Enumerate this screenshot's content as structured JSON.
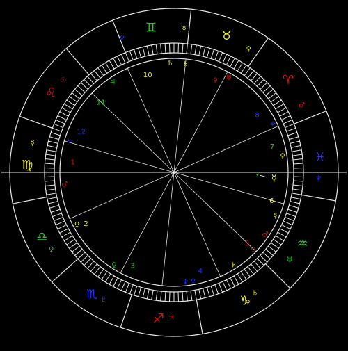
{
  "colors": {
    "background": "#000000",
    "lines": "#e6e6e6",
    "fire": "#e01010",
    "earth": "#f0f020",
    "air": "#20d020",
    "water": "#2030ff"
  },
  "zodiac_ring": [
    {
      "glyph": "♊",
      "name": "gemini-icon",
      "color": "#20d020",
      "angle": 99
    },
    {
      "glyph": "♉",
      "name": "taurus-icon",
      "color": "#f0f020",
      "angle": 69
    },
    {
      "glyph": "♈",
      "name": "aries-icon",
      "color": "#e01010",
      "angle": 39
    },
    {
      "glyph": "♓",
      "name": "pisces-icon",
      "color": "#2030ff",
      "angle": 6
    },
    {
      "glyph": "♒",
      "name": "aquarius-icon",
      "color": "#20d020",
      "angle": -29
    },
    {
      "glyph": "♑",
      "name": "capricorn-icon",
      "color": "#f0f020",
      "angle": -61
    },
    {
      "glyph": "♐",
      "name": "sagittarius-icon",
      "color": "#e01010",
      "angle": -96
    },
    {
      "glyph": "♏",
      "name": "scorpio-icon",
      "color": "#2030ff",
      "angle": -124
    },
    {
      "glyph": "♎",
      "name": "libra-icon",
      "color": "#20d020",
      "angle": -154
    },
    {
      "glyph": "♍",
      "name": "virgo-icon",
      "color": "#f0f020",
      "angle": 177
    },
    {
      "glyph": "♌",
      "name": "leo-icon",
      "color": "#e01010",
      "angle": 147
    }
  ],
  "ruler_glyphs": [
    {
      "glyph": "☿",
      "name": "mercury-ruler-icon",
      "color": "#f0f020",
      "angle": 86
    },
    {
      "glyph": "♀",
      "name": "venus-ruler-icon",
      "color": "#f0f020",
      "angle": 59
    },
    {
      "glyph": "♂",
      "name": "mars-ruler-icon",
      "color": "#e01010",
      "angle": 28
    },
    {
      "glyph": "♆",
      "name": "neptune-ruler-icon",
      "color": "#2030ff",
      "angle": -2
    },
    {
      "glyph": "♅",
      "name": "uranus-ruler-icon",
      "color": "#20d020",
      "angle": -37
    },
    {
      "glyph": "♄",
      "name": "saturn-ruler-icon",
      "color": "#f0f020",
      "angle": -56
    },
    {
      "glyph": "♃",
      "name": "jupiter-ruler-icon",
      "color": "#e01010",
      "angle": -91
    },
    {
      "glyph": "♇",
      "name": "pluto-ruler-icon",
      "color": "#2030ff",
      "angle": -119
    },
    {
      "glyph": "♀",
      "name": "venus-ruler-icon-2",
      "color": "#20d020",
      "angle": -148
    },
    {
      "glyph": "☿",
      "name": "mercury-ruler-icon-2",
      "color": "#f0f020",
      "angle": 168
    },
    {
      "glyph": "☉",
      "name": "sun-ruler-icon",
      "color": "#e01010",
      "angle": 140
    },
    {
      "glyph": "♆",
      "name": "neptune-ruler-icon-2",
      "color": "#2030ff",
      "angle": 111
    }
  ],
  "houses": [
    {
      "label": "10",
      "color": "#f0f020",
      "angle": 105
    },
    {
      "label": "9",
      "color": "#e01010",
      "angle": 66
    },
    {
      "label": "8",
      "color": "#2030ff",
      "angle": 35
    },
    {
      "label": "7",
      "color": "#20d020",
      "angle": 15
    },
    {
      "label": "6",
      "color": "#f0f020",
      "angle": -16
    },
    {
      "label": "5",
      "color": "#e01010",
      "angle": -44
    },
    {
      "label": "4",
      "color": "#2030ff",
      "angle": -75
    },
    {
      "label": "3",
      "color": "#20d020",
      "angle": -114
    },
    {
      "label": "2",
      "color": "#f0f020",
      "angle": -150
    },
    {
      "label": "1",
      "color": "#e01010",
      "angle": 174
    },
    {
      "label": "12",
      "color": "#2030ff",
      "angle": 156
    },
    {
      "label": "11",
      "color": "#20d020",
      "angle": 136
    }
  ],
  "cusp_glyphs": [
    {
      "glyph": "♄",
      "name": "saturn-cusp-icon",
      "color": "#f0f020",
      "angle": 92
    },
    {
      "glyph": "♅",
      "name": "uranus-cusp-icon",
      "color": "#e01010",
      "angle": 60
    },
    {
      "glyph": "♆",
      "name": "neptune-cusp-icon",
      "color": "#2030ff",
      "angle": 26
    },
    {
      "glyph": "♀",
      "name": "venus-cusp-icon",
      "color": "#f0f020",
      "angle": 9
    },
    {
      "glyph": "☿",
      "name": "mercury-cusp-icon",
      "color": "#f0f020",
      "angle": -23
    },
    {
      "glyph": "♀",
      "name": "venus-cusp-icon-2",
      "color": "#e01010",
      "angle": -44
    },
    {
      "glyph": "♂",
      "name": "mars-cusp-icon",
      "color": "#e01010",
      "angle": -34
    },
    {
      "glyph": "♄",
      "name": "saturn-cusp-icon-2",
      "color": "#f0f020",
      "angle": -57
    },
    {
      "glyph": "♆",
      "name": "neptune-cusp-icon-2",
      "color": "#2030ff",
      "angle": -84
    },
    {
      "glyph": "♆",
      "name": "neptune-cusp-icon-3",
      "color": "#2030ff",
      "angle": -80
    },
    {
      "glyph": "♀",
      "name": "venus-cusp-icon-3",
      "color": "#20d020",
      "angle": -123
    },
    {
      "glyph": "♀",
      "name": "venus-cusp-icon-4",
      "color": "#f0f020",
      "angle": -152
    },
    {
      "glyph": "♂",
      "name": "mars-cusp-icon-2",
      "color": "#e01010",
      "angle": -174
    },
    {
      "glyph": "♄",
      "name": "uranus-cusp-icon-2",
      "color": "#2030ff",
      "angle": 163
    },
    {
      "glyph": "♃",
      "name": "jupiter-cusp-icon",
      "color": "#20d020",
      "angle": 124
    },
    {
      "glyph": "♄",
      "name": "saturn-cusp-icon-3",
      "color": "#f0f020",
      "angle": 84
    }
  ],
  "planets": [
    {
      "glyph": "☿",
      "name": "mercury-planet-icon",
      "color": "#f0f020",
      "angle": -3
    }
  ]
}
